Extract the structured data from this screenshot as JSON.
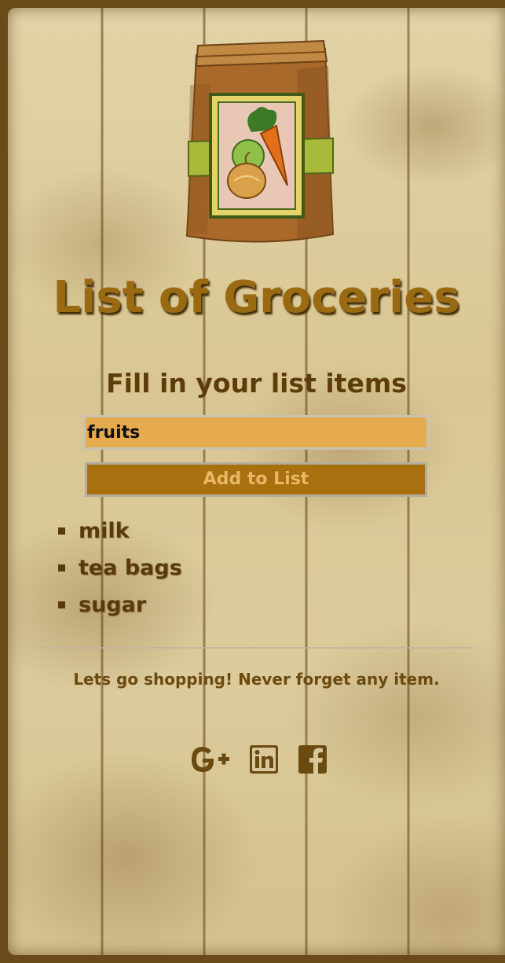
{
  "header": {
    "title": "List of Groceries",
    "subtitle": "Fill in your list items"
  },
  "form": {
    "input_value": "fruits",
    "add_button_label": "Add to List"
  },
  "list": {
    "items": [
      {
        "label": "milk"
      },
      {
        "label": "tea bags"
      },
      {
        "label": "sugar"
      }
    ]
  },
  "footer": {
    "tagline": "Lets go shopping! Never forget any item.",
    "social": [
      {
        "icon": "google-plus-icon"
      },
      {
        "icon": "linkedin-icon"
      },
      {
        "icon": "facebook-icon"
      }
    ]
  },
  "colors": {
    "title": "#9a6a12",
    "input_bg": "#e6ab4f",
    "button_bg": "#a9700f",
    "button_text": "#e8b866",
    "text_dark": "#5a3a0b",
    "frame": "#6b4a19"
  }
}
